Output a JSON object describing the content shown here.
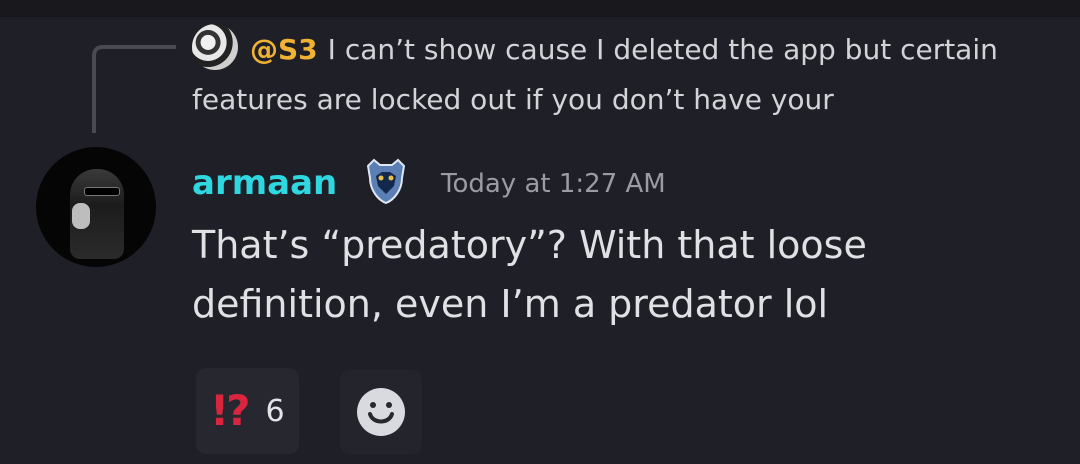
{
  "reply": {
    "mention": "@S3",
    "text": "I can’t show cause I deleted the app but certain features are locked out if you don’t have your"
  },
  "message": {
    "username": "armaan",
    "timestamp": "Today at 1:27 AM",
    "content": "That’s “predatory”? With that loose definition, even I’m a predator lol"
  },
  "reactions": [
    {
      "emoji": "⁉️",
      "count": "6"
    }
  ],
  "icons": {
    "badge": "grizzlies-badge-icon",
    "add_reaction": "smiley-add-reaction-icon"
  },
  "colors": {
    "background": "#1f1f27",
    "mention": "#f0b232",
    "username": "#2fd8e0",
    "reaction_emoji": "#d9263e"
  }
}
